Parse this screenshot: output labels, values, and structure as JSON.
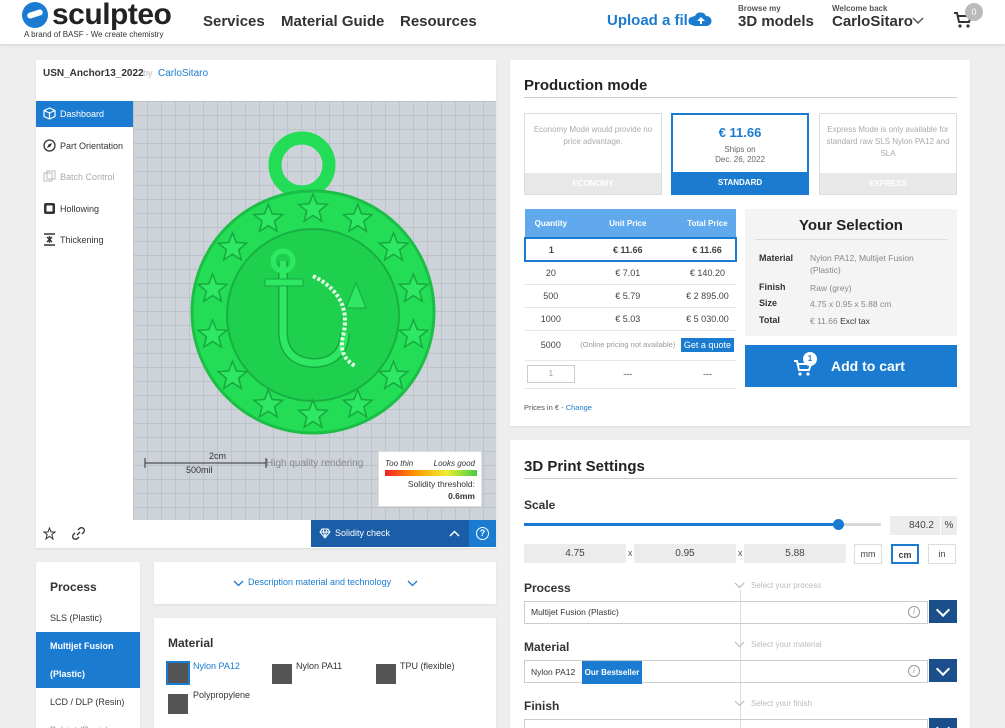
{
  "header": {
    "brand": "sculpteo",
    "tagline": "A brand of BASF - We create chemistry",
    "nav": [
      "Services",
      "Material Guide",
      "Resources"
    ],
    "upload_label": "Upload a file",
    "browse_small": "Browse my",
    "browse_big": "3D models",
    "welcome_small": "Welcome back",
    "username": "CarloSitaro",
    "cart_count": "0",
    "accent": "#1a7bd1"
  },
  "viewer": {
    "model_name": "USN_Anchor13_2022",
    "by": "by",
    "author": "CarloSitaro",
    "sidebar": [
      {
        "label": "Dashboard",
        "icon": "cube-icon"
      },
      {
        "label": "Part Orientation",
        "icon": "compass-icon"
      },
      {
        "label": "Batch Control",
        "icon": "batch-icon"
      },
      {
        "label": "Hollowing",
        "icon": "hollow-square-icon"
      },
      {
        "label": "Thickening",
        "icon": "thickening-icon"
      }
    ],
    "scale_cm": "2cm",
    "scale_mil": "500mil",
    "quality_text": "High quality rendering",
    "too_thin": "Too thin",
    "looks_good": "Looks good",
    "threshold_label": "Solidity threshold:",
    "threshold_value": "0.6mm",
    "solidity_label": "Solidity check",
    "help": "?",
    "model_color": "#22dd55"
  },
  "description_link": "Description material and technology",
  "process_list": {
    "title": "Process",
    "items": [
      "SLS (Plastic)",
      "Multijet Fusion",
      "(Plastic)",
      "LCD / DLP (Resin)",
      "Polyjet (Resin)"
    ]
  },
  "material_panel": {
    "title": "Material",
    "items": [
      "Nylon PA12",
      "Nylon PA11",
      "TPU (flexible)",
      "Polypropylene"
    ]
  },
  "production": {
    "title": "Production mode",
    "economy_text": "Economy Mode would provide no price advantage.",
    "economy_label": "ECONOMY",
    "standard_price": "€ 11.66",
    "ships_on": "Ships on",
    "ship_date": "Dec. 26, 2022",
    "standard_label": "STANDARD",
    "express_text": "Express Mode is only available for standard raw SLS Nylon PA12 and SLA",
    "express_label": "EXPRESS",
    "table_headers": [
      "Quantity",
      "Unit Price",
      "Total Price"
    ],
    "rows": [
      {
        "qty": "1",
        "unit": "€ 11.66",
        "total": "€ 11.66"
      },
      {
        "qty": "20",
        "unit": "€ 7.01",
        "total": "€ 140.20"
      },
      {
        "qty": "500",
        "unit": "€ 5.79",
        "total": "€ 2 895.00"
      },
      {
        "qty": "1000",
        "unit": "€ 5.03",
        "total": "€ 5 030.00"
      }
    ],
    "row5000_qty": "5000",
    "row5000_note": "(Online pricing not available)",
    "quote_label": "Get a quote",
    "custom_qty": "1",
    "dash": "---",
    "prices_in": "Prices in € -",
    "change": "Change",
    "selection_title": "Your Selection",
    "selection": {
      "material_k": "Material",
      "material_v": "Nylon PA12, Multijet Fusion (Plastic)",
      "finish_k": "Finish",
      "finish_v": "Raw (grey)",
      "size_k": "Size",
      "size_v": "4.75 x 0.95 x 5.88 cm",
      "total_k": "Total",
      "total_v": "€ 11.66",
      "excl": "Excl tax"
    },
    "add_to_cart": "Add to cart",
    "cart_badge": "1"
  },
  "print_settings": {
    "title": "3D Print Settings",
    "scale_label": "Scale",
    "scale_value": "840.2",
    "scale_unit": "%",
    "scale_fraction": 0.88,
    "dims": [
      "4.75",
      "0.95",
      "5.88"
    ],
    "times": "x",
    "units": [
      "mm",
      "cm",
      "in"
    ],
    "process_label": "Process",
    "process_hint": "Select your process",
    "process_value": "Multijet Fusion (Plastic)",
    "material_label": "Material",
    "material_hint": "Select your material",
    "material_value": "Nylon PA12",
    "bestseller": "Our Bestseller",
    "finish_label": "Finish",
    "finish_hint": "Select your finish",
    "info": "i"
  }
}
